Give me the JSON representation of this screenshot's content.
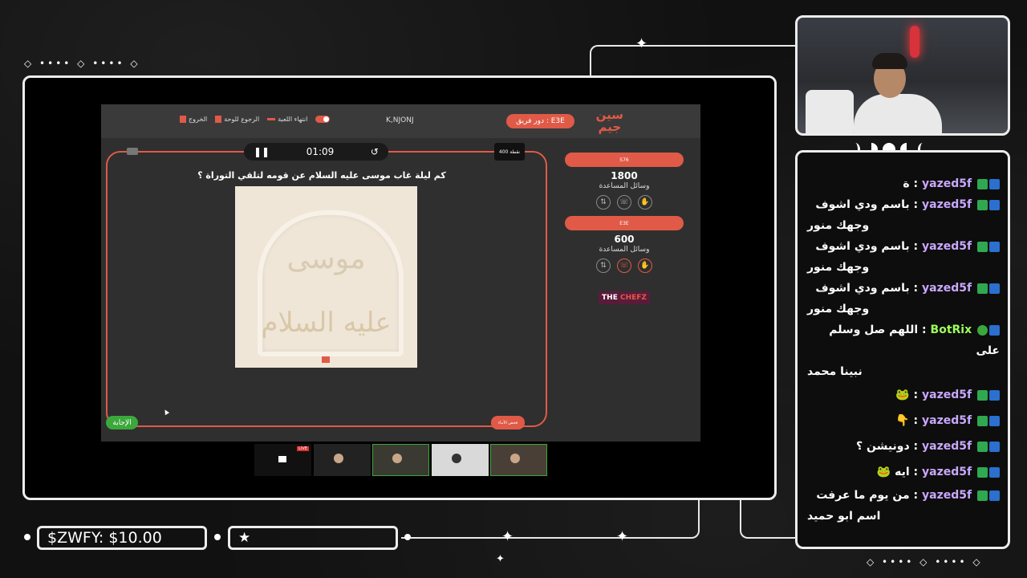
{
  "game": {
    "team_turn": "دور فريق : E3E",
    "team_name": "K,NJONJ",
    "actions": [
      "الخروج",
      "الرجوع للوحة",
      "انتهاء اللعبة"
    ],
    "timer": "01:09",
    "points_badge": "400 نقطة",
    "question": "كم ليلة غاب موسى عليه السلام عن قومه لتلقي التوراة ؟",
    "image_word1": "موسى",
    "image_word2": "عليه السلام",
    "answer_label": "الإجابة",
    "hint_label": "فحص الأنباء",
    "teams": [
      {
        "name": "S76",
        "score": "1800",
        "aids_label": "وسائل المساعدة"
      },
      {
        "name": "E3E",
        "score": "600",
        "aids_label": "وسائل المساعدة"
      }
    ],
    "sponsor_a": "THE",
    "sponsor_b": "CHEFZ",
    "live_tag": "LIVE"
  },
  "chat": [
    {
      "user": "yazed5f",
      "text": "ة"
    },
    {
      "user": "yazed5f",
      "text": "باسم ودي اشوف",
      "cont": "وجهك منور"
    },
    {
      "user": "yazed5f",
      "text": "باسم ودي اشوف",
      "cont": "وجهك منور"
    },
    {
      "user": "yazed5f",
      "text": "باسم ودي اشوف",
      "cont": "وجهك منور"
    },
    {
      "user": "BotRix",
      "text": "اللهم صل وسلم على",
      "cont": "نبينا محمد"
    },
    {
      "user": "yazed5f",
      "text": "🐸"
    },
    {
      "user": "yazed5f",
      "text": "👇"
    },
    {
      "user": "yazed5f",
      "text": "دونيشن ؟"
    },
    {
      "user": "yazed5f",
      "text": "ايه 🐸"
    },
    {
      "user": "yazed5f",
      "text": "من يوم ما عرفت",
      "cont": "اسم ابو حميد"
    }
  ],
  "bottom": {
    "money": "$ZWFY: $10.00"
  },
  "icons": [
    "pause-icon",
    "history-icon",
    "star-icon",
    "sparkle-icon",
    "moon-icon",
    "verified-icon"
  ]
}
